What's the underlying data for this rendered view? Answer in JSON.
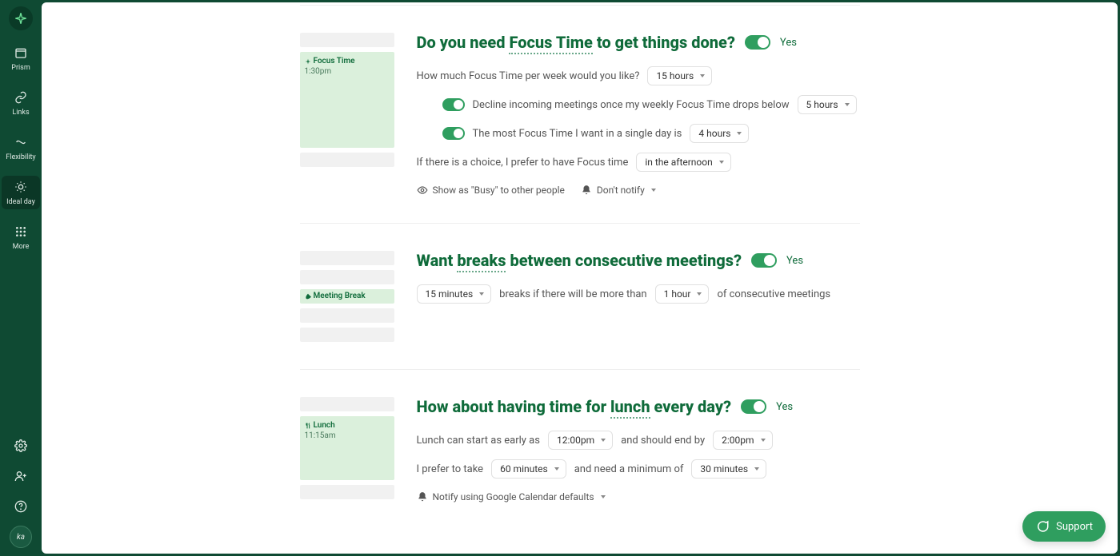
{
  "sidebar": {
    "items": [
      {
        "label": "Prism"
      },
      {
        "label": "Links"
      },
      {
        "label": "Flexibility"
      },
      {
        "label": "Ideal day"
      },
      {
        "label": "More"
      }
    ],
    "avatar_initials": "ka"
  },
  "sections": {
    "focus": {
      "title_pre": "Do you need ",
      "title_ul": "Focus Time",
      "title_post": " to get things done?",
      "yes": "Yes",
      "preview_title": "Focus Time",
      "preview_time": "1:30pm",
      "q_per_week": "How much Focus Time per week would you like?",
      "per_week_val": "15 hours",
      "decline_label": "Decline incoming meetings once my weekly Focus Time drops below",
      "decline_val": "5 hours",
      "daily_label": "The most Focus Time I want in a single day is",
      "daily_val": "4 hours",
      "pref_label": "If there is a choice, I prefer to have Focus time",
      "pref_val": "in the afternoon",
      "show_busy": "Show as \"Busy\" to other people",
      "notify": "Don't notify"
    },
    "breaks": {
      "title_pre": "Want ",
      "title_ul": "breaks",
      "title_post": " between consecutive meetings?",
      "yes": "Yes",
      "preview_title": "Meeting Break",
      "duration_val": "15 minutes",
      "mid1": "breaks if there will be more than",
      "threshold_val": "1 hour",
      "mid2": "of consecutive meetings"
    },
    "lunch": {
      "title_pre": "How about having time for ",
      "title_ul": "lunch",
      "title_post": " every day?",
      "yes": "Yes",
      "preview_title": "Lunch",
      "preview_time": "11:15am",
      "start_label": "Lunch can start as early as",
      "start_val": "12:00pm",
      "end_label": "and should end by",
      "end_val": "2:00pm",
      "take_label": "I prefer to take",
      "take_val": "60 minutes",
      "min_label": "and need a minimum of",
      "min_val": "30 minutes",
      "notify": "Notify using Google Calendar defaults"
    }
  },
  "support_label": "Support"
}
